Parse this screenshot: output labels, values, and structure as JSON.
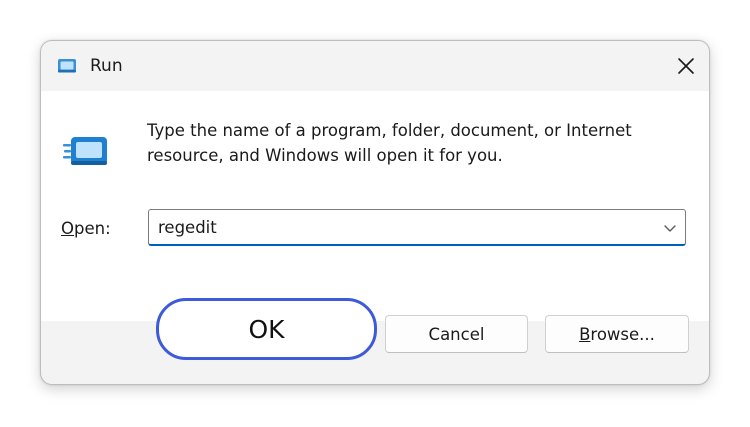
{
  "window": {
    "title": "Run",
    "accent_color": "#3d5bd9",
    "focus_color": "#005fb8"
  },
  "titlebar": {
    "icon": "run-app-icon",
    "close_icon": "close-icon"
  },
  "content": {
    "icon": "run-app-icon",
    "message_line1": "Type the name of a program, folder, document, or Internet",
    "message_line2": "resource, and Windows will open it for you.",
    "open_label_mnemonic": "O",
    "open_label_rest": "pen:",
    "open_value": "regedit",
    "dropdown_icon": "chevron-down-icon"
  },
  "buttons": {
    "ok_label": "OK",
    "cancel_label": "Cancel",
    "browse_mnemonic": "B",
    "browse_rest": "rowse..."
  }
}
